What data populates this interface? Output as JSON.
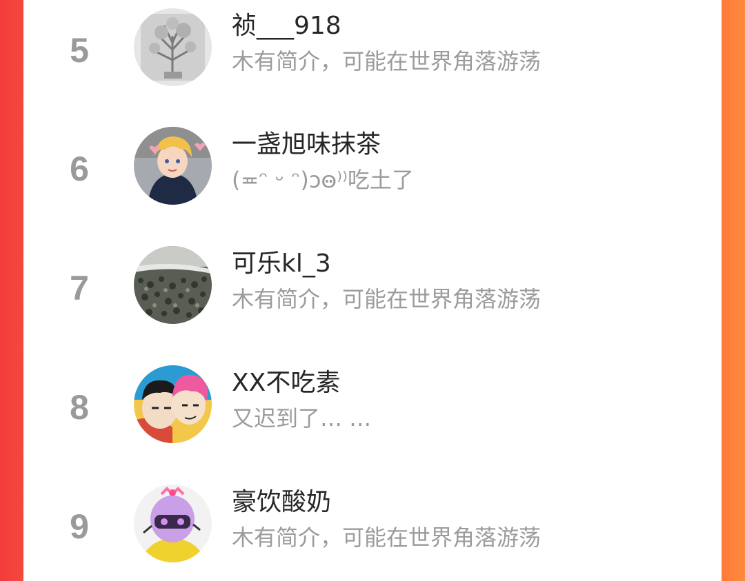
{
  "users": [
    {
      "rank": "5",
      "name": "祯___918",
      "bio": "木有简介，可能在世界角落游荡",
      "avatar_icon": "tree-sketch-avatar-icon"
    },
    {
      "rank": "6",
      "name": "一盏旭味抹茶",
      "bio": "(≖ᵔ ᵕ ᵔ)ɔꙫ⁾⁾吃土了",
      "avatar_icon": "anime-boy-avatar-icon"
    },
    {
      "rank": "7",
      "name": "可乐kl_3",
      "bio": "木有简介，可能在世界角落游荡",
      "avatar_icon": "pebbles-avatar-icon"
    },
    {
      "rank": "8",
      "name": "XX不吃素",
      "bio": "又迟到了… …",
      "avatar_icon": "cartoon-duo-avatar-icon"
    },
    {
      "rank": "9",
      "name": "豪饮酸奶",
      "bio": "木有简介，可能在世界角落游荡",
      "avatar_icon": "helmet-girl-avatar-icon"
    }
  ],
  "colors": {
    "left_edge": "#f23b3b",
    "right_edge": "#ff7a3a",
    "rank_text": "#9a9a9a",
    "name_text": "#262626",
    "bio_text": "#9b9b9b"
  }
}
